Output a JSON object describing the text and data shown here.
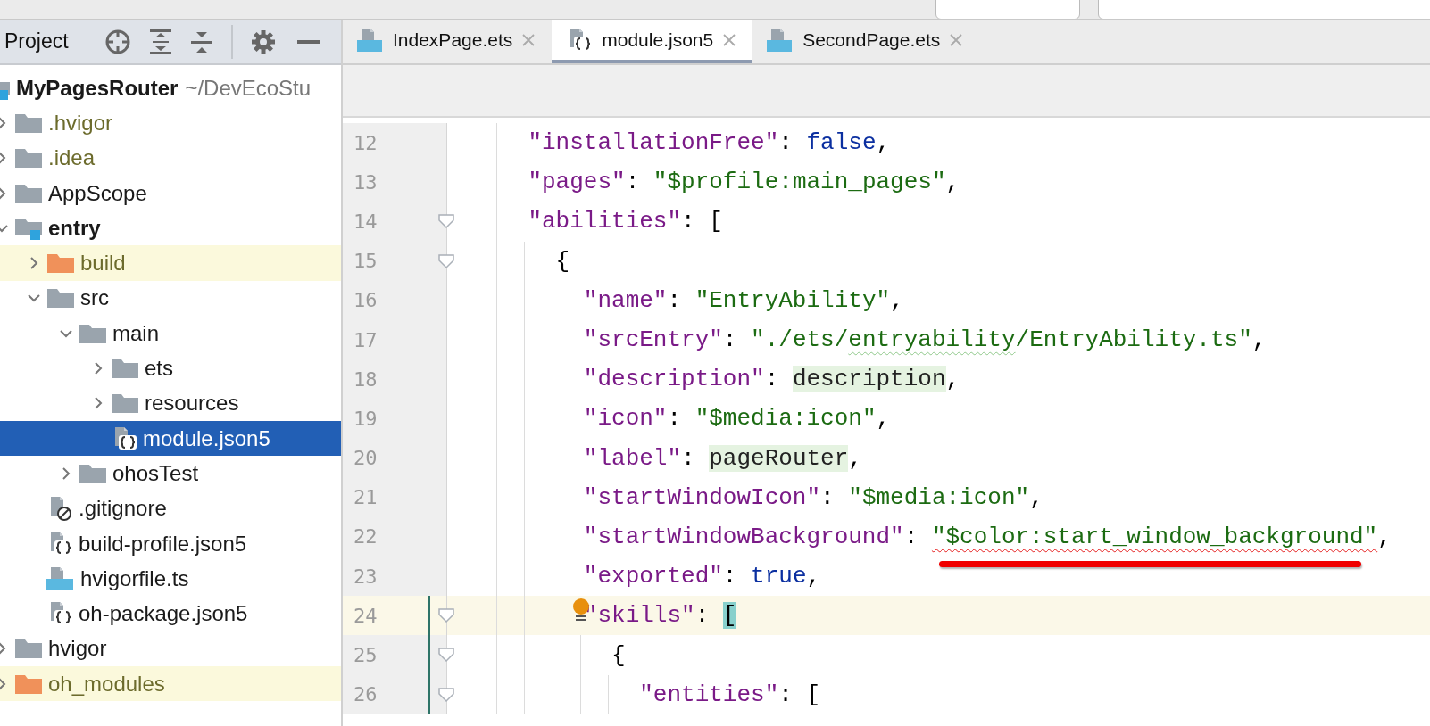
{
  "project_panel": {
    "title": "Project",
    "tree": [
      {
        "label": "MyPagesRouter",
        "path": "~/DevEcoStu",
        "kind": "module",
        "bold": true,
        "ignored": false,
        "excluded": false,
        "selected": false,
        "children": [
          {
            "label": ".hvigor",
            "kind": "folder",
            "expanded": false,
            "ignored": true,
            "excluded": false,
            "selected": false
          },
          {
            "label": ".idea",
            "kind": "folder",
            "expanded": false,
            "ignored": true,
            "excluded": false,
            "selected": false
          },
          {
            "label": "AppScope",
            "kind": "folder",
            "expanded": false,
            "ignored": false,
            "excluded": false,
            "selected": false
          },
          {
            "label": "entry",
            "kind": "module",
            "bold": true,
            "expanded": true,
            "ignored": false,
            "excluded": false,
            "selected": false,
            "children": [
              {
                "label": "build",
                "kind": "folder",
                "expanded": false,
                "ignored": false,
                "excluded": true,
                "selected": false
              },
              {
                "label": "src",
                "kind": "folder",
                "expanded": true,
                "ignored": false,
                "excluded": false,
                "selected": false,
                "children": [
                  {
                    "label": "main",
                    "kind": "folder",
                    "expanded": true,
                    "ignored": false,
                    "excluded": false,
                    "selected": false,
                    "children": [
                      {
                        "label": "ets",
                        "kind": "folder",
                        "expanded": false,
                        "ignored": false,
                        "excluded": false,
                        "selected": false
                      },
                      {
                        "label": "resources",
                        "kind": "folder",
                        "expanded": false,
                        "ignored": false,
                        "excluded": false,
                        "selected": false
                      },
                      {
                        "label": "module.json5",
                        "kind": "json",
                        "ignored": false,
                        "excluded": false,
                        "selected": true
                      }
                    ]
                  },
                  {
                    "label": "ohosTest",
                    "kind": "folder",
                    "expanded": false,
                    "ignored": false,
                    "excluded": false,
                    "selected": false
                  }
                ]
              },
              {
                "label": ".gitignore",
                "kind": "ignore",
                "ignored": false,
                "excluded": false,
                "selected": false
              },
              {
                "label": "build-profile.json5",
                "kind": "json",
                "ignored": false,
                "excluded": false,
                "selected": false
              },
              {
                "label": "hvigorfile.ts",
                "kind": "ts",
                "ignored": false,
                "excluded": false,
                "selected": false
              },
              {
                "label": "oh-package.json5",
                "kind": "json",
                "ignored": false,
                "excluded": false,
                "selected": false
              }
            ]
          },
          {
            "label": "hvigor",
            "kind": "folder",
            "expanded": false,
            "ignored": false,
            "excluded": false,
            "selected": false
          },
          {
            "label": "oh_modules",
            "kind": "folder",
            "expanded": false,
            "ignored": false,
            "excluded": true,
            "selected": false
          }
        ]
      }
    ]
  },
  "tabs": [
    {
      "label": "IndexPage.ets",
      "kind": "ets",
      "selected": false
    },
    {
      "label": "module.json5",
      "kind": "json",
      "selected": true
    },
    {
      "label": "SecondPage.ets",
      "kind": "ets",
      "selected": false
    }
  ],
  "editor": {
    "lines": [
      {
        "number": "12",
        "tokens": [
          {
            "kind": "key",
            "text": "    \"installationFree\""
          },
          {
            "kind": "punct",
            "text": ": "
          },
          {
            "kind": "keyword",
            "text": "false"
          },
          {
            "kind": "punct",
            "text": ","
          }
        ]
      },
      {
        "number": "13",
        "tokens": [
          {
            "kind": "key",
            "text": "    \"pages\""
          },
          {
            "kind": "punct",
            "text": ": "
          },
          {
            "kind": "string",
            "text": "\"$profile:main_pages\""
          },
          {
            "kind": "punct",
            "text": ","
          }
        ]
      },
      {
        "number": "14",
        "fold": true,
        "tokens": [
          {
            "kind": "key",
            "text": "    \"abilities\""
          },
          {
            "kind": "punct",
            "text": ": ["
          }
        ]
      },
      {
        "number": "15",
        "fold": true,
        "tokens": [
          {
            "kind": "punct",
            "text": "      {"
          }
        ]
      },
      {
        "number": "16",
        "tokens": [
          {
            "kind": "key",
            "text": "        \"name\""
          },
          {
            "kind": "punct",
            "text": ": "
          },
          {
            "kind": "string",
            "text": "\"EntryAbility\""
          },
          {
            "kind": "punct",
            "text": ","
          }
        ]
      },
      {
        "number": "17",
        "tokens": [
          {
            "kind": "key",
            "text": "        \"srcEntry\""
          },
          {
            "kind": "punct",
            "text": ": "
          },
          {
            "kind": "string",
            "text": "\"./ets/"
          },
          {
            "kind": "string",
            "text": "entryability",
            "warning": true
          },
          {
            "kind": "string",
            "text": "/EntryAbility.ts\""
          },
          {
            "kind": "punct",
            "text": ","
          }
        ]
      },
      {
        "number": "18",
        "tokens": [
          {
            "kind": "key",
            "text": "        \"description\""
          },
          {
            "kind": "punct",
            "text": ": "
          },
          {
            "kind": "reference",
            "text": "description"
          },
          {
            "kind": "punct",
            "text": ","
          }
        ]
      },
      {
        "number": "19",
        "tokens": [
          {
            "kind": "key",
            "text": "        \"icon\""
          },
          {
            "kind": "punct",
            "text": ": "
          },
          {
            "kind": "string",
            "text": "\"$media:icon\""
          },
          {
            "kind": "punct",
            "text": ","
          }
        ]
      },
      {
        "number": "20",
        "tokens": [
          {
            "kind": "key",
            "text": "        \"label\""
          },
          {
            "kind": "punct",
            "text": ": "
          },
          {
            "kind": "reference",
            "text": "pageRouter"
          },
          {
            "kind": "punct",
            "text": ","
          }
        ]
      },
      {
        "number": "21",
        "tokens": [
          {
            "kind": "key",
            "text": "        \"startWindowIcon\""
          },
          {
            "kind": "punct",
            "text": ": "
          },
          {
            "kind": "string",
            "text": "\"$media:icon\""
          },
          {
            "kind": "punct",
            "text": ","
          }
        ]
      },
      {
        "number": "22",
        "tokens": [
          {
            "kind": "key",
            "text": "        \"startWindowBackground\""
          },
          {
            "kind": "punct",
            "text": ": "
          },
          {
            "kind": "string",
            "text": "\"$color:start_window_background\"",
            "error": true,
            "annotated": true
          },
          {
            "kind": "punct",
            "text": ","
          }
        ]
      },
      {
        "number": "23",
        "tokens": [
          {
            "kind": "key",
            "text": "        \"exported\""
          },
          {
            "kind": "punct",
            "text": ": "
          },
          {
            "kind": "keyword",
            "text": "true"
          },
          {
            "kind": "punct",
            "text": ","
          }
        ]
      },
      {
        "number": "24",
        "fold": true,
        "current": true,
        "bulb": true,
        "changed": true,
        "tokens": [
          {
            "kind": "key",
            "text": "        \"skills\""
          },
          {
            "kind": "punct",
            "text": ": "
          },
          {
            "kind": "brace-match",
            "text": "["
          }
        ]
      },
      {
        "number": "25",
        "fold": true,
        "changed": true,
        "tokens": [
          {
            "kind": "punct",
            "text": "          {"
          }
        ]
      },
      {
        "number": "26",
        "fold": true,
        "changed": true,
        "tokens": [
          {
            "kind": "key",
            "text": "            \"entities\""
          },
          {
            "kind": "punct",
            "text": ": ["
          }
        ]
      }
    ]
  }
}
